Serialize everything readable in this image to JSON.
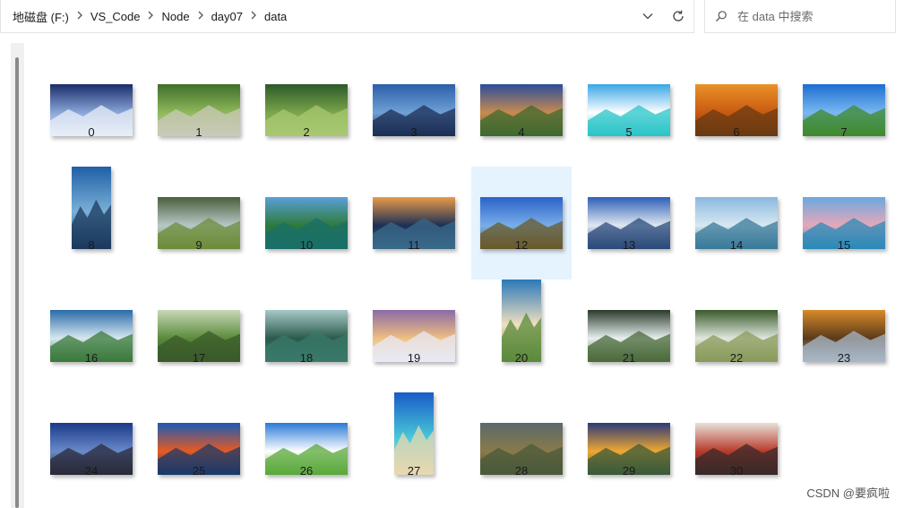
{
  "breadcrumb": [
    {
      "label": "地磁盘 (F:)"
    },
    {
      "label": "VS_Code"
    },
    {
      "label": "Node"
    },
    {
      "label": "day07"
    },
    {
      "label": "data"
    }
  ],
  "breadcrumb_separator_icon": "chevron-right-icon",
  "address_buttons": {
    "dropdown_icon": "chevron-down-icon",
    "refresh_icon": "refresh-icon"
  },
  "search": {
    "placeholder": "在 data 中搜索",
    "icon": "search-icon"
  },
  "selected_index": 12,
  "files": [
    {
      "name": "0",
      "orientation": "landscape",
      "colors": [
        "#1a2d6b",
        "#8aa6d8",
        "#e8eef7"
      ]
    },
    {
      "name": "1",
      "orientation": "landscape",
      "colors": [
        "#3f6f2a",
        "#8fb85a",
        "#c9c9b8"
      ]
    },
    {
      "name": "2",
      "orientation": "landscape",
      "colors": [
        "#2d5a2a",
        "#7aa54a",
        "#a8c870"
      ]
    },
    {
      "name": "3",
      "orientation": "landscape",
      "colors": [
        "#2b5fa8",
        "#6fa0d6",
        "#1c2f55"
      ]
    },
    {
      "name": "4",
      "orientation": "landscape",
      "colors": [
        "#2a4e9c",
        "#c98a4e",
        "#3f6a2f"
      ]
    },
    {
      "name": "5",
      "orientation": "landscape",
      "colors": [
        "#3aa7e6",
        "#ffffff",
        "#28c4c8"
      ]
    },
    {
      "name": "6",
      "orientation": "landscape",
      "colors": [
        "#e9922a",
        "#c85a10",
        "#6b3a12"
      ]
    },
    {
      "name": "7",
      "orientation": "landscape",
      "colors": [
        "#1d6ed1",
        "#79b8f0",
        "#3f8a2c"
      ]
    },
    {
      "name": "8",
      "orientation": "portrait",
      "colors": [
        "#1f5fa6",
        "#7ab0d8",
        "#1b3a5e"
      ]
    },
    {
      "name": "9",
      "orientation": "landscape",
      "colors": [
        "#4a5f3a",
        "#b8c8c8",
        "#6c8c3a"
      ]
    },
    {
      "name": "10",
      "orientation": "landscape",
      "colors": [
        "#5aa0d8",
        "#2e7a3a",
        "#1a6f6a"
      ]
    },
    {
      "name": "11",
      "orientation": "landscape",
      "colors": [
        "#e89a48",
        "#1b2f55",
        "#3a6a8a"
      ]
    },
    {
      "name": "12",
      "orientation": "landscape",
      "colors": [
        "#2a62c8",
        "#78aee8",
        "#6a5a2a"
      ]
    },
    {
      "name": "13",
      "orientation": "landscape",
      "colors": [
        "#2d5fb8",
        "#e0e8f0",
        "#2a4a7a"
      ]
    },
    {
      "name": "14",
      "orientation": "landscape",
      "colors": [
        "#8ab8e0",
        "#d8e8f0",
        "#3a7a9a"
      ]
    },
    {
      "name": "15",
      "orientation": "landscape",
      "colors": [
        "#6aa8e0",
        "#e8a8b8",
        "#2a8ab8"
      ]
    },
    {
      "name": "16",
      "orientation": "landscape",
      "colors": [
        "#2a6aa8",
        "#d8e8f0",
        "#3a7a3a"
      ]
    },
    {
      "name": "17",
      "orientation": "landscape",
      "colors": [
        "#c8d8b8",
        "#5a8a3a",
        "#3a5a2a"
      ]
    },
    {
      "name": "18",
      "orientation": "landscape",
      "colors": [
        "#a8c8c8",
        "#2a5a4a",
        "#3a7a6a"
      ]
    },
    {
      "name": "19",
      "orientation": "landscape",
      "colors": [
        "#8a6aa8",
        "#f0c080",
        "#e8eaf5"
      ]
    },
    {
      "name": "20",
      "orientation": "portrait",
      "colors": [
        "#2a78b8",
        "#f0e0c0",
        "#5a8a3a"
      ]
    },
    {
      "name": "21",
      "orientation": "landscape",
      "colors": [
        "#2a3a2a",
        "#e8f0f0",
        "#4a6a3a"
      ]
    },
    {
      "name": "22",
      "orientation": "landscape",
      "colors": [
        "#3a5a2a",
        "#e0e8e0",
        "#8a9a5a"
      ]
    },
    {
      "name": "23",
      "orientation": "landscape",
      "colors": [
        "#d88a2a",
        "#5a3a1a",
        "#a8b8c8"
      ]
    },
    {
      "name": "24",
      "orientation": "landscape",
      "colors": [
        "#1a3a8a",
        "#6a8ac8",
        "#2a2a3a"
      ]
    },
    {
      "name": "25",
      "orientation": "landscape",
      "colors": [
        "#1a5ab8",
        "#e85a20",
        "#1a3a6a"
      ]
    },
    {
      "name": "26",
      "orientation": "landscape",
      "colors": [
        "#2a7ad8",
        "#ffffff",
        "#5aa83a"
      ]
    },
    {
      "name": "27",
      "orientation": "portrait",
      "colors": [
        "#1a5ac8",
        "#48c8d8",
        "#e8d8b0"
      ]
    },
    {
      "name": "28",
      "orientation": "landscape",
      "colors": [
        "#5a6a6a",
        "#8a7a4a",
        "#4a5a3a"
      ]
    },
    {
      "name": "29",
      "orientation": "landscape",
      "colors": [
        "#2a3a7a",
        "#f0a830",
        "#3a5a3a"
      ]
    },
    {
      "name": "30",
      "orientation": "landscape",
      "colors": [
        "#e8e0d8",
        "#b83a2a",
        "#3a2a2a"
      ]
    }
  ],
  "watermark": "CSDN @要疯啦"
}
